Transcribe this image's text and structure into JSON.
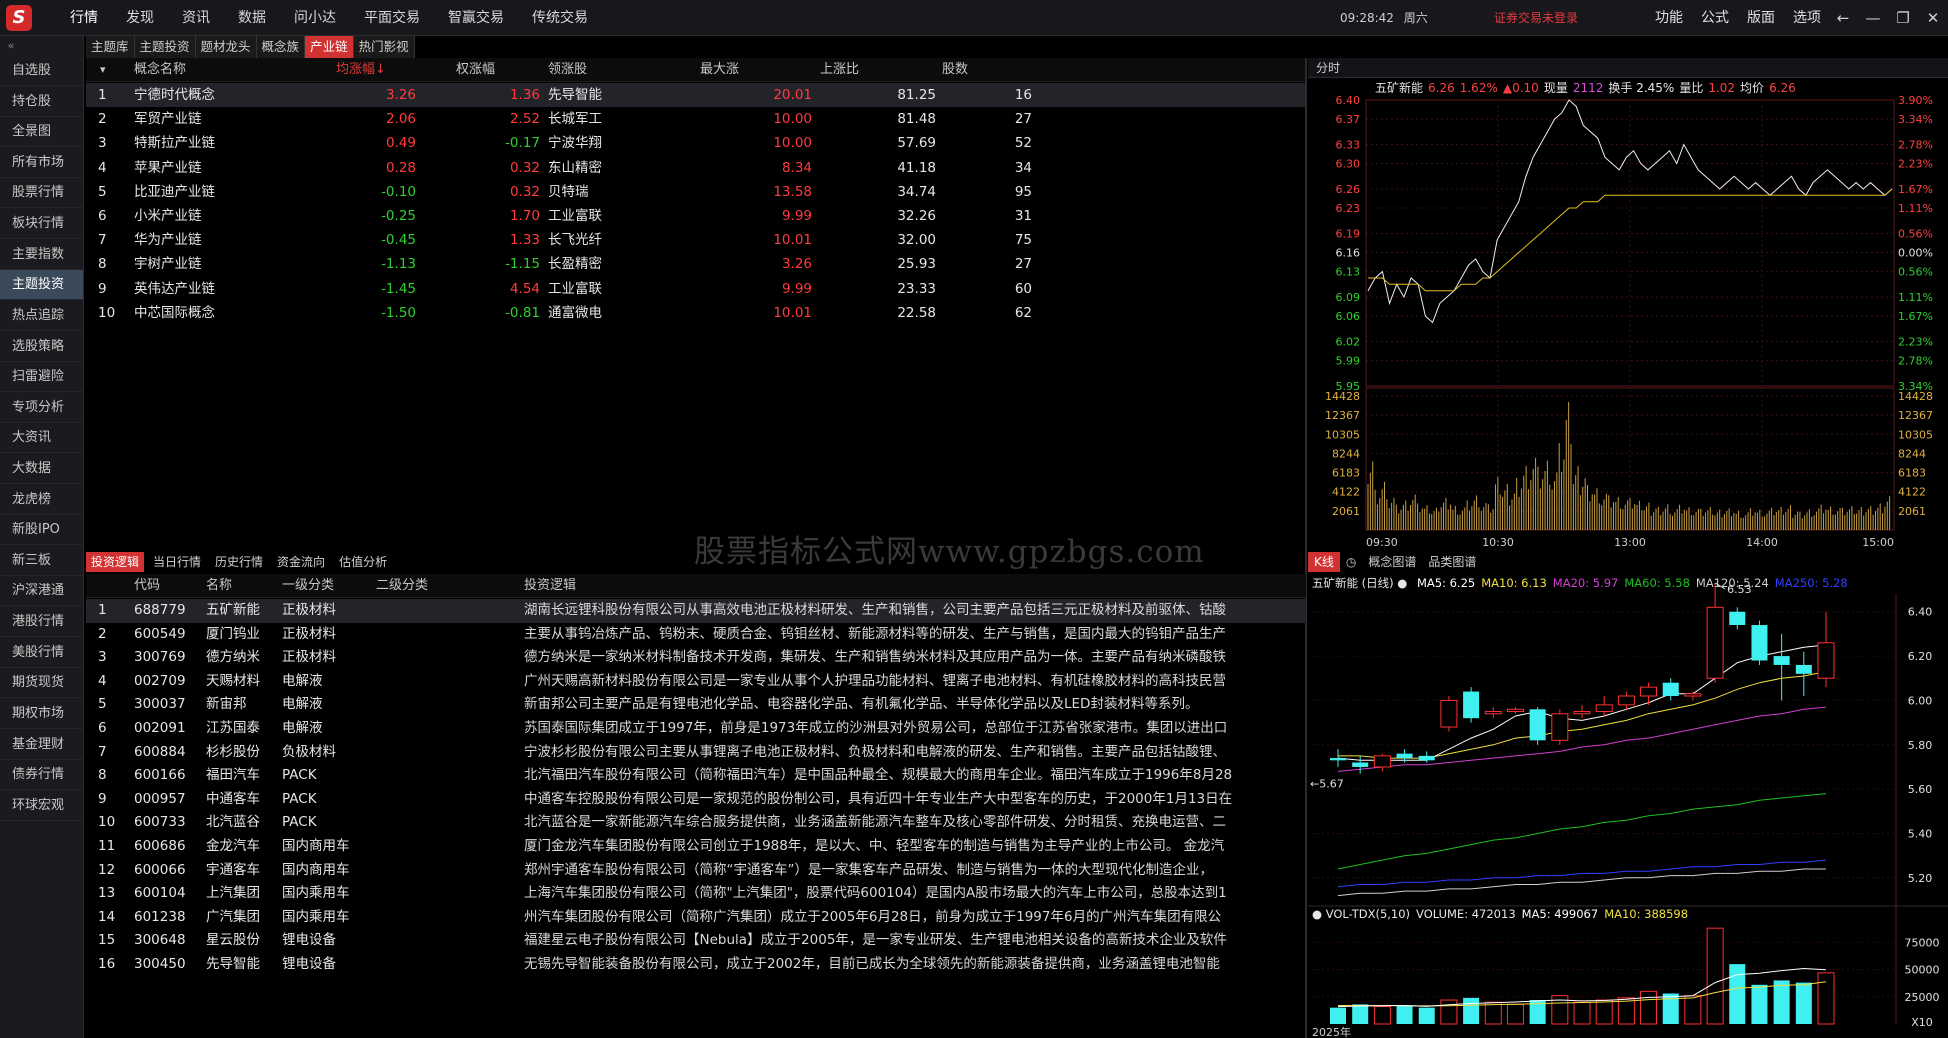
{
  "app": {
    "logo": "S",
    "menu": [
      "行情",
      "发现",
      "资讯",
      "数据",
      "问小达",
      "平面交易",
      "智赢交易",
      "传统交易"
    ],
    "active_menu": 0,
    "clock": {
      "time": "09:28:42",
      "day": "周六"
    },
    "login_status": "证券交易未登录",
    "right_menu": [
      "功能",
      "公式",
      "版面",
      "选项"
    ],
    "window_controls": [
      "back-arrow-icon",
      "minimize-icon",
      "restore-icon",
      "close-icon"
    ]
  },
  "sidebar": {
    "collapse_icon": "«",
    "items": [
      "自选股",
      "持仓股",
      "全景图",
      "所有市场",
      "股票行情",
      "板块行情",
      "主要指数",
      "主题投资",
      "热点追踪",
      "选股策略",
      "扫雷避险",
      "专项分析",
      "大资讯",
      "大数据",
      "龙虎榜",
      "新股IPO",
      "新三板",
      "沪深港通",
      "港股行情",
      "美股行情",
      "期货现货",
      "期权市场",
      "基金理财",
      "债券行情",
      "环球宏观"
    ],
    "active": 7
  },
  "theme_tabs": {
    "items": [
      "主题库",
      "主题投资",
      "题材龙头",
      "概念族",
      "产业链",
      "热门影视"
    ],
    "active": 4
  },
  "upper_table": {
    "header_arrow": "▾",
    "columns": [
      "概念名称",
      "均涨幅↓",
      "权涨幅",
      "领涨股",
      "最大涨",
      "上涨比",
      "股数"
    ],
    "rows": [
      {
        "idx": "1",
        "name": "宁德时代概念",
        "avg": "3.26",
        "w": "1.36",
        "lead": "先导智能",
        "max": "20.01",
        "ratio": "81.25",
        "cnt": "16",
        "avg_c": "red",
        "w_c": "red",
        "max_c": "red"
      },
      {
        "idx": "2",
        "name": "军贸产业链",
        "avg": "2.06",
        "w": "2.52",
        "lead": "长城军工",
        "max": "10.00",
        "ratio": "81.48",
        "cnt": "27",
        "avg_c": "red",
        "w_c": "red",
        "max_c": "red"
      },
      {
        "idx": "3",
        "name": "特斯拉产业链",
        "avg": "0.49",
        "w": "-0.17",
        "lead": "宁波华翔",
        "max": "10.00",
        "ratio": "57.69",
        "cnt": "52",
        "avg_c": "red",
        "w_c": "green",
        "max_c": "red"
      },
      {
        "idx": "4",
        "name": "苹果产业链",
        "avg": "0.28",
        "w": "0.32",
        "lead": "东山精密",
        "max": "8.34",
        "ratio": "41.18",
        "cnt": "34",
        "avg_c": "red",
        "w_c": "red",
        "max_c": "red"
      },
      {
        "idx": "5",
        "name": "比亚迪产业链",
        "avg": "-0.10",
        "w": "0.32",
        "lead": "贝特瑞",
        "max": "13.58",
        "ratio": "34.74",
        "cnt": "95",
        "avg_c": "green",
        "w_c": "red",
        "max_c": "red"
      },
      {
        "idx": "6",
        "name": "小米产业链",
        "avg": "-0.25",
        "w": "1.70",
        "lead": "工业富联",
        "max": "9.99",
        "ratio": "32.26",
        "cnt": "31",
        "avg_c": "green",
        "w_c": "red",
        "max_c": "red"
      },
      {
        "idx": "7",
        "name": "华为产业链",
        "avg": "-0.45",
        "w": "1.33",
        "lead": "长飞光纤",
        "max": "10.01",
        "ratio": "32.00",
        "cnt": "75",
        "avg_c": "green",
        "w_c": "red",
        "max_c": "red"
      },
      {
        "idx": "8",
        "name": "宇树产业链",
        "avg": "-1.13",
        "w": "-1.15",
        "lead": "长盈精密",
        "max": "3.26",
        "ratio": "25.93",
        "cnt": "27",
        "avg_c": "green",
        "w_c": "green",
        "max_c": "red"
      },
      {
        "idx": "9",
        "name": "英伟达产业链",
        "avg": "-1.45",
        "w": "4.54",
        "lead": "工业富联",
        "max": "9.99",
        "ratio": "23.33",
        "cnt": "60",
        "avg_c": "green",
        "w_c": "red",
        "max_c": "red"
      },
      {
        "idx": "10",
        "name": "中芯国际概念",
        "avg": "-1.50",
        "w": "-0.81",
        "lead": "通富微电",
        "max": "10.01",
        "ratio": "22.58",
        "cnt": "62",
        "avg_c": "green",
        "w_c": "green",
        "max_c": "red"
      }
    ]
  },
  "watermark": "股票指标公式网www.gpzbgs.com",
  "lower_tabs": {
    "items": [
      "投资逻辑",
      "当日行情",
      "历史行情",
      "资金流向",
      "估值分析"
    ],
    "active": 0
  },
  "lower_table": {
    "columns": [
      "代码",
      "名称",
      "一级分类",
      "二级分类",
      "投资逻辑"
    ],
    "rows": [
      {
        "idx": "1",
        "code": "688779",
        "name": "五矿新能",
        "c1": "正极材料",
        "c2": "",
        "logic": "湖南长远锂科股份有限公司从事高效电池正极材料研发、生产和销售，公司主要产品包括三元正极材料及前驱体、钴酸"
      },
      {
        "idx": "2",
        "code": "600549",
        "name": "厦门钨业",
        "c1": "正极材料",
        "c2": "",
        "logic": "主要从事钨冶炼产品、钨粉末、硬质合金、钨钼丝材、新能源材料等的研发、生产与销售，是国内最大的钨钼产品生产"
      },
      {
        "idx": "3",
        "code": "300769",
        "name": "德方纳米",
        "c1": "正极材料",
        "c2": "",
        "logic": "德方纳米是一家纳米材料制备技术开发商，集研发、生产和销售纳米材料及其应用产品为一体。主要产品有纳米磷酸铁"
      },
      {
        "idx": "4",
        "code": "002709",
        "name": "天赐材料",
        "c1": "电解液",
        "c2": "",
        "logic": "广州天赐高新材料股份有限公司是一家专业从事个人护理品功能材料、锂离子电池材料、有机硅橡胶材料的高科技民营"
      },
      {
        "idx": "5",
        "code": "300037",
        "name": "新宙邦",
        "c1": "电解液",
        "c2": "",
        "logic": "新宙邦公司主要产品是有锂电池化学品、电容器化学品、有机氟化学品、半导体化学品以及LED封装材料等系列。"
      },
      {
        "idx": "6",
        "code": "002091",
        "name": "江苏国泰",
        "c1": "电解液",
        "c2": "",
        "logic": "苏国泰国际集团成立于1997年，前身是1973年成立的沙洲县对外贸易公司，总部位于江苏省张家港市。集团以进出口"
      },
      {
        "idx": "7",
        "code": "600884",
        "name": "杉杉股份",
        "c1": "负极材料",
        "c2": "",
        "logic": "宁波杉杉股份有限公司主要从事锂离子电池正极材料、负极材料和电解液的研发、生产和销售。主要产品包括钴酸锂、"
      },
      {
        "idx": "8",
        "code": "600166",
        "name": "福田汽车",
        "c1": "PACK",
        "c2": "",
        "logic": "北汽福田汽车股份有限公司（简称福田汽车）是中国品种最全、规模最大的商用车企业。福田汽车成立于1996年8月28"
      },
      {
        "idx": "9",
        "code": "000957",
        "name": "中通客车",
        "c1": "PACK",
        "c2": "",
        "logic": "中通客车控股股份有限公司是一家规范的股份制公司，具有近四十年专业生产大中型客车的历史，于2000年1月13日在"
      },
      {
        "idx": "10",
        "code": "600733",
        "name": "北汽蓝谷",
        "c1": "PACK",
        "c2": "",
        "logic": "北汽蓝谷是一家新能源汽车综合服务提供商，业务涵盖新能源汽车整车及核心零部件研发、分时租赁、充换电运营、二"
      },
      {
        "idx": "11",
        "code": "600686",
        "name": "金龙汽车",
        "c1": "国内商用车",
        "c2": "",
        "logic": "厦门金龙汽车集团股份有限公司创立于1988年，是以大、中、轻型客车的制造与销售为主导产业的上市公司。 金龙汽"
      },
      {
        "idx": "12",
        "code": "600066",
        "name": "宇通客车",
        "c1": "国内商用车",
        "c2": "",
        "logic": "郑州宇通客车股份有限公司（简称“宇通客车”）是一家集客车产品研发、制造与销售为一体的大型现代化制造企业，"
      },
      {
        "idx": "13",
        "code": "600104",
        "name": "上汽集团",
        "c1": "国内乘用车",
        "c2": "",
        "logic": "上海汽车集团股份有限公司（简称\"上汽集团\"，股票代码600104）是国内A股市场最大的汽车上市公司，总股本达到1"
      },
      {
        "idx": "14",
        "code": "601238",
        "name": "广汽集团",
        "c1": "国内乘用车",
        "c2": "",
        "logic": "州汽车集团股份有限公司（简称广汽集团）成立于2005年6月28日，前身为成立于1997年6月的广州汽车集团有限公"
      },
      {
        "idx": "15",
        "code": "300648",
        "name": "星云股份",
        "c1": "锂电设备",
        "c2": "",
        "logic": "福建星云电子股份有限公司【Nebula】成立于2005年，是一家专业研发、生产锂电池相关设备的高新技术企业及软件"
      },
      {
        "idx": "16",
        "code": "300450",
        "name": "先导智能",
        "c1": "锂电设备",
        "c2": "",
        "logic": "无锡先导智能装备股份有限公司，成立于2002年，目前已成长为全球领先的新能源装备提供商，业务涵盖锂电池智能"
      }
    ]
  },
  "timeshare": {
    "tab": "分时",
    "info": {
      "name": "五矿新能",
      "price": "6.26",
      "pct": "1.62%",
      "chg": "▲0.10",
      "vol_label": "现量",
      "vol": "2112",
      "turn": "换手 2.45%",
      "ratio_label": "量比",
      "ratio": "1.02",
      "avg_label": "均价",
      "avg": "6.26"
    },
    "price_ticks": [
      "6.40",
      "6.37",
      "6.33",
      "6.30",
      "6.26",
      "6.23",
      "6.19",
      "6.16",
      "6.13",
      "6.09",
      "6.06",
      "6.02",
      "5.99",
      "5.95"
    ],
    "pct_ticks": [
      "3.90%",
      "3.34%",
      "2.78%",
      "2.23%",
      "1.67%",
      "1.11%",
      "0.56%",
      "0.00%",
      "0.56%",
      "1.11%",
      "1.67%",
      "2.23%",
      "2.78%",
      "3.34%"
    ],
    "vol_ticks": [
      "14428",
      "12367",
      "10305",
      "8244",
      "6183",
      "4122",
      "2061"
    ],
    "time_ticks": [
      "09:30",
      "10:30",
      "13:00",
      "14:00",
      "15:00"
    ],
    "prev_close": 6.16,
    "price_range": [
      5.95,
      6.4
    ],
    "vol_max": 14428,
    "price_series": [
      6.1,
      6.12,
      6.13,
      6.08,
      6.11,
      6.09,
      6.12,
      6.11,
      6.06,
      6.05,
      6.08,
      6.09,
      6.1,
      6.12,
      6.14,
      6.15,
      6.13,
      6.12,
      6.18,
      6.2,
      6.22,
      6.24,
      6.28,
      6.31,
      6.33,
      6.35,
      6.37,
      6.38,
      6.4,
      6.39,
      6.36,
      6.35,
      6.34,
      6.31,
      6.3,
      6.29,
      6.31,
      6.32,
      6.3,
      6.29,
      6.3,
      6.31,
      6.32,
      6.3,
      6.33,
      6.31,
      6.29,
      6.28,
      6.27,
      6.26,
      6.27,
      6.28,
      6.27,
      6.26,
      6.27,
      6.26,
      6.25,
      6.26,
      6.27,
      6.28,
      6.26,
      6.25,
      6.27,
      6.28,
      6.29,
      6.28,
      6.27,
      6.26,
      6.27,
      6.26,
      6.27,
      6.26,
      6.25,
      6.26
    ],
    "avg_series": [
      6.12,
      6.12,
      6.12,
      6.11,
      6.11,
      6.11,
      6.11,
      6.11,
      6.1,
      6.1,
      6.1,
      6.1,
      6.1,
      6.11,
      6.11,
      6.11,
      6.12,
      6.12,
      6.13,
      6.14,
      6.15,
      6.16,
      6.17,
      6.18,
      6.19,
      6.2,
      6.21,
      6.22,
      6.23,
      6.23,
      6.24,
      6.24,
      6.24,
      6.25,
      6.25,
      6.25,
      6.25,
      6.25,
      6.25,
      6.25,
      6.25,
      6.25,
      6.25,
      6.25,
      6.25,
      6.25,
      6.25,
      6.25,
      6.25,
      6.25,
      6.25,
      6.25,
      6.25,
      6.25,
      6.25,
      6.25,
      6.25,
      6.25,
      6.25,
      6.25,
      6.25,
      6.25,
      6.25,
      6.25,
      6.25,
      6.25,
      6.25,
      6.25,
      6.25,
      6.25,
      6.25,
      6.25,
      6.25,
      6.26
    ],
    "vol_series": [
      9000,
      5000,
      6000,
      4000,
      3000,
      3500,
      4200,
      3000,
      2800,
      2500,
      3600,
      4000,
      3000,
      2800,
      3500,
      4100,
      3200,
      2900,
      6000,
      5200,
      4800,
      6500,
      8000,
      9000,
      7500,
      8200,
      6800,
      9800,
      14428,
      7200,
      6800,
      5600,
      5200,
      4500,
      4100,
      3900,
      3500,
      3600,
      3300,
      3100,
      2800,
      2900,
      3200,
      2600,
      3000,
      2700,
      2500,
      2400,
      2600,
      2300,
      2500,
      2700,
      2400,
      2200,
      2600,
      2400,
      2300,
      2500,
      2600,
      2800,
      2400,
      2300,
      2600,
      2700,
      3000,
      2800,
      2600,
      2500,
      2700,
      2600,
      2800,
      3000,
      3300,
      4200
    ]
  },
  "kline": {
    "tabs": [
      "K线",
      "概念图谱",
      "品类图谱"
    ],
    "active_tab": 0,
    "title": "五矿新能 (日线)",
    "ma": [
      {
        "label": "MA5: 6.25",
        "color": "#ffffff"
      },
      {
        "label": "MA10: 6.13",
        "color": "#f0e040"
      },
      {
        "label": "MA20: 5.97",
        "color": "#d040d0"
      },
      {
        "label": "MA60: 5.58",
        "color": "#20c020"
      },
      {
        "label": "MA120: 5.24",
        "color": "#d0d0d0"
      },
      {
        "label": "MA250: 5.28",
        "color": "#3040ff"
      }
    ],
    "price_ticks": [
      "6.40",
      "6.20",
      "6.00",
      "5.80",
      "5.60",
      "5.40",
      "5.20"
    ],
    "price_range": [
      5.1,
      6.48
    ],
    "high_label": "6.53",
    "low_label": "5.67",
    "candles": [
      {
        "o": 5.74,
        "h": 5.78,
        "l": 5.7,
        "c": 5.73
      },
      {
        "o": 5.72,
        "h": 5.75,
        "l": 5.67,
        "c": 5.7
      },
      {
        "o": 5.7,
        "h": 5.76,
        "l": 5.68,
        "c": 5.75
      },
      {
        "o": 5.76,
        "h": 5.78,
        "l": 5.72,
        "c": 5.74
      },
      {
        "o": 5.75,
        "h": 5.77,
        "l": 5.72,
        "c": 5.73
      },
      {
        "o": 5.88,
        "h": 6.02,
        "l": 5.86,
        "c": 6.0
      },
      {
        "o": 6.04,
        "h": 6.06,
        "l": 5.9,
        "c": 5.92
      },
      {
        "o": 5.94,
        "h": 5.97,
        "l": 5.92,
        "c": 5.95
      },
      {
        "o": 5.95,
        "h": 5.97,
        "l": 5.94,
        "c": 5.96
      },
      {
        "o": 5.96,
        "h": 5.97,
        "l": 5.8,
        "c": 5.82
      },
      {
        "o": 5.82,
        "h": 5.96,
        "l": 5.8,
        "c": 5.94
      },
      {
        "o": 5.94,
        "h": 5.98,
        "l": 5.92,
        "c": 5.95
      },
      {
        "o": 5.95,
        "h": 6.02,
        "l": 5.93,
        "c": 5.98
      },
      {
        "o": 5.98,
        "h": 6.04,
        "l": 5.96,
        "c": 6.02
      },
      {
        "o": 6.02,
        "h": 6.08,
        "l": 5.98,
        "c": 6.06
      },
      {
        "o": 6.08,
        "h": 6.1,
        "l": 6.0,
        "c": 6.02
      },
      {
        "o": 6.02,
        "h": 6.04,
        "l": 6.0,
        "c": 6.03
      },
      {
        "o": 6.1,
        "h": 6.53,
        "l": 6.08,
        "c": 6.42
      },
      {
        "o": 6.4,
        "h": 6.42,
        "l": 6.32,
        "c": 6.34
      },
      {
        "o": 6.34,
        "h": 6.36,
        "l": 6.16,
        "c": 6.18
      },
      {
        "o": 6.2,
        "h": 6.3,
        "l": 6.0,
        "c": 6.16
      },
      {
        "o": 6.16,
        "h": 6.22,
        "l": 6.02,
        "c": 6.12
      },
      {
        "o": 6.1,
        "h": 6.4,
        "l": 6.06,
        "c": 6.26
      }
    ],
    "ma5": [
      5.74,
      5.73,
      5.73,
      5.73,
      5.73,
      5.78,
      5.83,
      5.87,
      5.93,
      5.95,
      5.92,
      5.91,
      5.93,
      5.96,
      5.99,
      6.03,
      6.03,
      6.1,
      6.17,
      6.2,
      6.22,
      6.24,
      6.25
    ],
    "ma10": [
      5.75,
      5.75,
      5.74,
      5.74,
      5.74,
      5.76,
      5.78,
      5.8,
      5.83,
      5.84,
      5.86,
      5.87,
      5.89,
      5.91,
      5.94,
      5.96,
      5.98,
      6.01,
      6.05,
      6.08,
      6.1,
      6.11,
      6.13
    ],
    "ma20": [
      5.68,
      5.69,
      5.7,
      5.71,
      5.71,
      5.72,
      5.73,
      5.74,
      5.75,
      5.76,
      5.77,
      5.79,
      5.8,
      5.82,
      5.83,
      5.85,
      5.87,
      5.89,
      5.91,
      5.93,
      5.94,
      5.96,
      5.97
    ],
    "ma60": [
      5.24,
      5.26,
      5.28,
      5.3,
      5.31,
      5.33,
      5.35,
      5.37,
      5.38,
      5.4,
      5.42,
      5.43,
      5.45,
      5.46,
      5.48,
      5.49,
      5.51,
      5.52,
      5.53,
      5.55,
      5.56,
      5.57,
      5.58
    ],
    "ma120": [
      5.12,
      5.13,
      5.13,
      5.14,
      5.14,
      5.15,
      5.15,
      5.16,
      5.17,
      5.17,
      5.18,
      5.18,
      5.19,
      5.2,
      5.2,
      5.21,
      5.21,
      5.22,
      5.22,
      5.23,
      5.23,
      5.24,
      5.24
    ],
    "ma250": [
      5.16,
      5.17,
      5.17,
      5.18,
      5.18,
      5.19,
      5.19,
      5.2,
      5.2,
      5.21,
      5.21,
      5.22,
      5.22,
      5.23,
      5.23,
      5.24,
      5.25,
      5.25,
      5.26,
      5.26,
      5.27,
      5.27,
      5.28
    ],
    "vol_label": "VOL-TDX(5,10)",
    "vol_values": {
      "volume": "VOLUME: 472013",
      "ma5": "MA5: 499067",
      "ma10": "MA10: 388598"
    },
    "vol_ticks": [
      "75000",
      "50000",
      "25000",
      "X10"
    ],
    "vol_max": 90000,
    "volumes": [
      15000,
      18000,
      16000,
      17000,
      15000,
      22000,
      24000,
      20000,
      18000,
      22000,
      26000,
      20000,
      22000,
      24000,
      30000,
      28000,
      26000,
      88000,
      55000,
      36000,
      40000,
      38000,
      47000
    ],
    "vol_ma5": [
      16000,
      16500,
      16800,
      17000,
      16200,
      17600,
      18800,
      19600,
      20200,
      21200,
      22000,
      21200,
      21600,
      22800,
      24400,
      25000,
      26000,
      38000,
      45400,
      46600,
      49000,
      51000,
      49900
    ],
    "vol_ma10": [
      17000,
      17000,
      16900,
      16800,
      16600,
      16800,
      17200,
      17800,
      18200,
      18700,
      19300,
      19700,
      20200,
      21000,
      22400,
      23100,
      24000,
      28800,
      33000,
      33900,
      35500,
      36000,
      38800
    ],
    "year_label": "2025年"
  }
}
